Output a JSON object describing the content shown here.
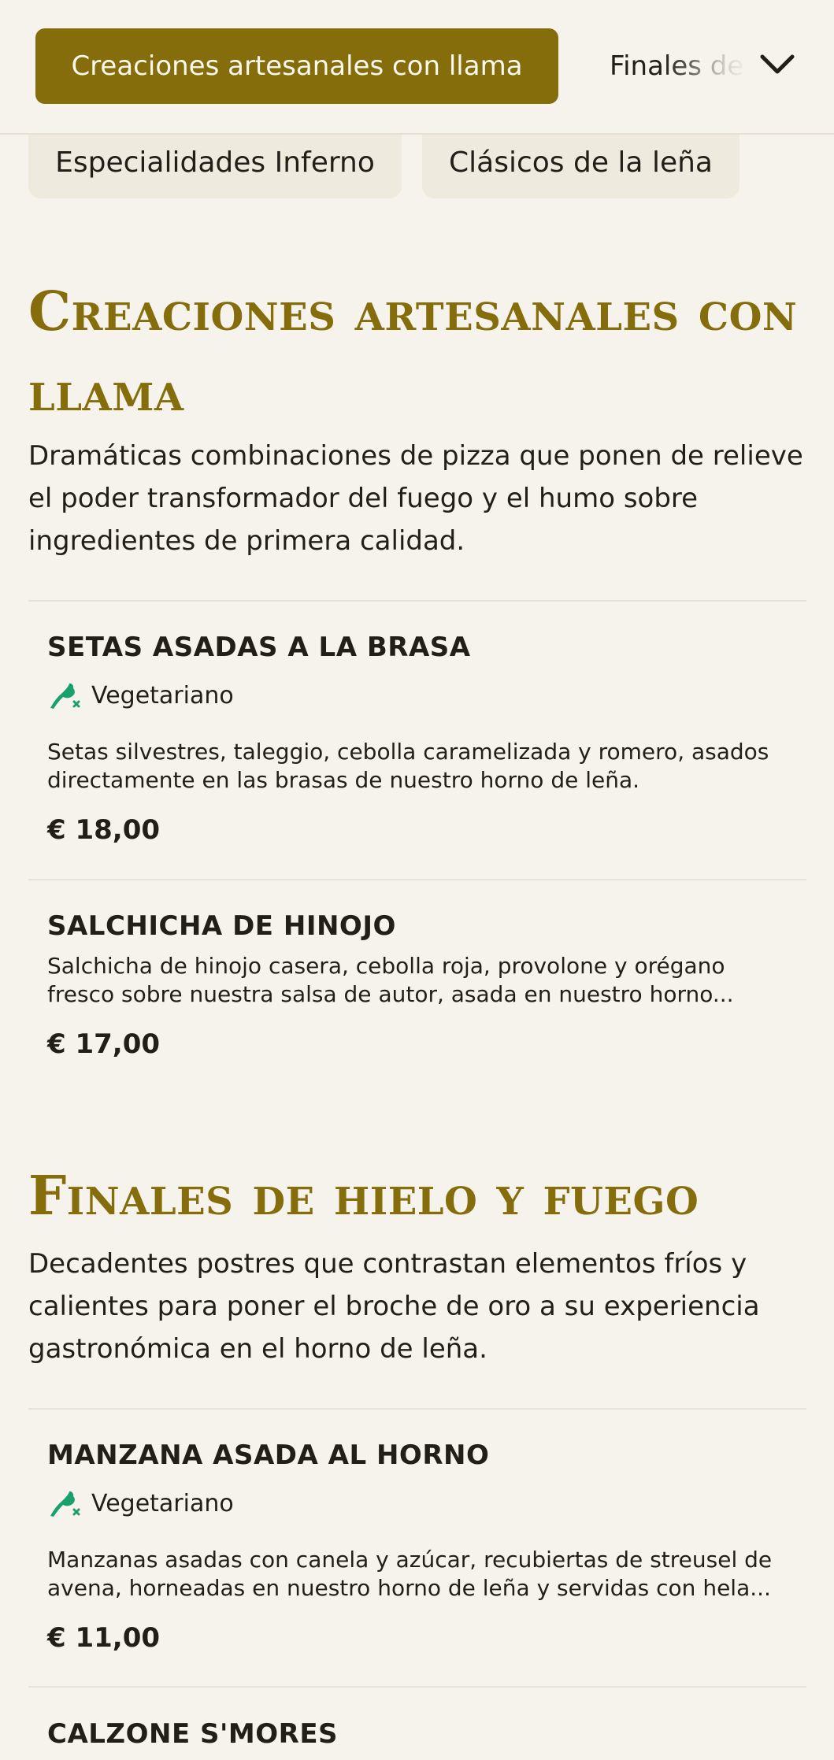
{
  "nav": {
    "active_tab": "Creaciones artesanales con llama",
    "next_tab": "Finales de hielo y fuego",
    "pills": [
      "Especialidades Inferno",
      "Clásicos de la leña"
    ]
  },
  "sections": [
    {
      "title": "Creaciones artesanales con llama",
      "description": "Dramáticas combinaciones de pizza que ponen de relieve el poder transformador del fuego y el humo sobre ingredientes de primera calidad.",
      "items": [
        {
          "name": "SETAS ASADAS A LA BRASA",
          "badge": "Vegetariano",
          "description": "Setas silvestres, taleggio, cebolla caramelizada y romero, asados directamente en las brasas de nuestro horno de leña.",
          "price": "€ 18,00"
        },
        {
          "name": "SALCHICHA DE HINOJO",
          "description": "Salchicha de hinojo casera, cebolla roja, provolone y orégano fresco sobre nuestra salsa de autor, asada en nuestro horno...",
          "price": "€ 17,00"
        }
      ]
    },
    {
      "title": "Finales de hielo y fuego",
      "description": "Decadentes postres que contrastan elementos fríos y calientes para poner el broche de oro a su experiencia gastronómica en el horno de leña.",
      "items": [
        {
          "name": "MANZANA ASADA AL HORNO",
          "badge": "Vegetariano",
          "description": "Manzanas asadas con canela y azúcar, recubiertas de streusel de avena, horneadas en nuestro horno de leña y servidas con hela...",
          "price": "€ 11,00"
        },
        {
          "name": "CALZONE S'MORES"
        }
      ]
    }
  ],
  "colors": {
    "background": "#f6f3ec",
    "accent": "#866d0b",
    "pill_background": "#eeeade",
    "vegetarian_icon": "#1aa06b",
    "text": "#221f18"
  },
  "icons": {
    "chevron": "chevron-down-icon",
    "vegetarian": "leaf-icon"
  }
}
